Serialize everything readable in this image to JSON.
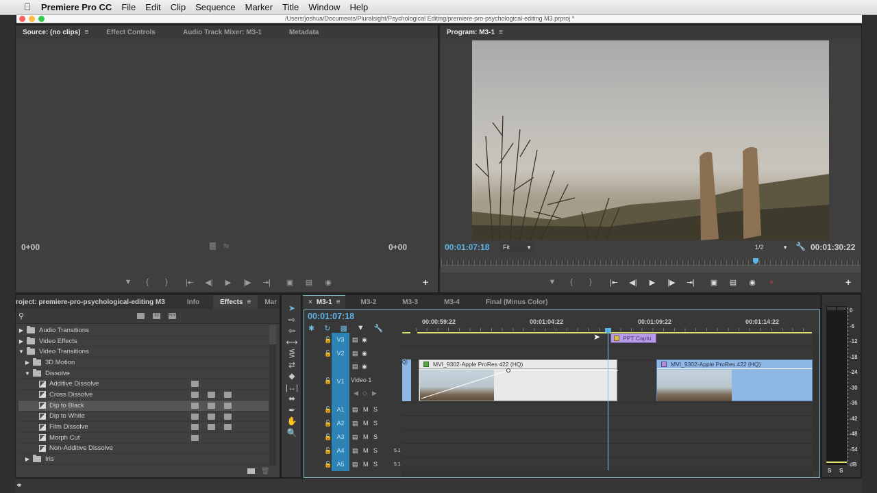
{
  "menubar": {
    "app_name": "Premiere Pro CC",
    "items": [
      "File",
      "Edit",
      "Clip",
      "Sequence",
      "Marker",
      "Title",
      "Window",
      "Help"
    ]
  },
  "window": {
    "path": "/Users/joshua/Documents/Pluralsight/Psychological Editing/premiere-pro-psychological-editing M3.prproj *"
  },
  "source_panel": {
    "tabs": [
      "Source: (no clips)",
      "Effect Controls",
      "Audio Track Mixer: M3-1",
      "Metadata"
    ],
    "active_tab": 0,
    "timecode_in": "0+00",
    "timecode_out": "0+00"
  },
  "program_panel": {
    "tab": "Program: M3-1",
    "current_timecode": "00:01:07:18",
    "zoom_fit": "Fit",
    "resolution": "1/2",
    "duration": "00:01:30:22",
    "playhead_fraction": 0.75
  },
  "transport": {
    "buttons": [
      "add-marker",
      "mark-in",
      "mark-out",
      "go-to-in",
      "step-back",
      "play",
      "step-forward",
      "go-to-out",
      "insert",
      "overwrite",
      "export-frame"
    ]
  },
  "project_panel": {
    "tabs": [
      "roject: premiere-pro-psychological-editing M3",
      "Info",
      "Effects",
      "Mar"
    ],
    "active_tab": 2,
    "more_label": "»",
    "search_placeholder": "",
    "filter_badges": [
      "accelerated",
      "32",
      "YUV"
    ],
    "tree": [
      {
        "label": "Audio Transitions",
        "type": "folder",
        "depth": 0,
        "expanded": false
      },
      {
        "label": "Video Effects",
        "type": "folder",
        "depth": 0,
        "expanded": false
      },
      {
        "label": "Video Transitions",
        "type": "folder",
        "depth": 0,
        "expanded": true
      },
      {
        "label": "3D Motion",
        "type": "folder",
        "depth": 1,
        "expanded": false
      },
      {
        "label": "Dissolve",
        "type": "folder",
        "depth": 1,
        "expanded": true
      },
      {
        "label": "Additive Dissolve",
        "type": "effect",
        "depth": 2,
        "badges": 1
      },
      {
        "label": "Cross Dissolve",
        "type": "effect",
        "depth": 2,
        "badges": 3
      },
      {
        "label": "Dip to Black",
        "type": "effect",
        "depth": 2,
        "badges": 3,
        "selected": true
      },
      {
        "label": "Dip to White",
        "type": "effect",
        "depth": 2,
        "badges": 3
      },
      {
        "label": "Film Dissolve",
        "type": "effect",
        "depth": 2,
        "badges": 3
      },
      {
        "label": "Morph Cut",
        "type": "effect",
        "depth": 2,
        "badges": 1
      },
      {
        "label": "Non-Additive Dissolve",
        "type": "effect",
        "depth": 2,
        "badges": 0
      },
      {
        "label": "Iris",
        "type": "folder",
        "depth": 1,
        "expanded": false
      }
    ]
  },
  "tools": [
    "selection",
    "track-select-forward",
    "track-select-backward",
    "ripple-edit",
    "rolling-edit",
    "rate-stretch",
    "razor",
    "slip",
    "slide",
    "pen",
    "hand",
    "zoom"
  ],
  "timeline": {
    "tabs": [
      "M3-1",
      "M3-2",
      "M3-3",
      "M3-4",
      "Final (Minus Color)"
    ],
    "active_tab": 0,
    "close_label": "×",
    "current_timecode": "00:01:07:18",
    "ruler_labels": [
      "00:00:59:22",
      "00:01:04:22",
      "00:01:09:22",
      "00:01:14:22"
    ],
    "video_tracks": [
      {
        "name": "V3",
        "label": ""
      },
      {
        "name": "V2",
        "label": ""
      },
      {
        "name": "V1",
        "label": "Video 1"
      }
    ],
    "audio_tracks": [
      {
        "name": "A1",
        "mute": "M",
        "solo": "S",
        "extra": ""
      },
      {
        "name": "A2",
        "mute": "M",
        "solo": "S",
        "extra": ""
      },
      {
        "name": "A3",
        "mute": "M",
        "solo": "S",
        "extra": ""
      },
      {
        "name": "A4",
        "mute": "M",
        "solo": "S",
        "extra": "5.1"
      },
      {
        "name": "A5",
        "mute": "M",
        "solo": "S",
        "extra": "5.1"
      }
    ],
    "clips": {
      "v3_clip": "PPT Captu",
      "v1_clip_left_edge": "Q)",
      "v1_clip_a": "MVI_9302-Apple ProRes 422 (HQ)",
      "v1_clip_b": "MVI_9302-Apple ProRes 422 (HQ)"
    }
  },
  "audio_meter": {
    "scale": [
      "0",
      "-6",
      "-12",
      "-18",
      "-24",
      "-30",
      "-36",
      "-42",
      "-48",
      "-54",
      "dB"
    ],
    "solo_labels": [
      "S",
      "S"
    ]
  },
  "colors": {
    "accent_blue": "#5cb3e6",
    "track_blue": "#2d83b3",
    "clip_v3": "#b79be6",
    "clip_v1b": "#8fb7e3",
    "work_area": "#dede6a"
  }
}
